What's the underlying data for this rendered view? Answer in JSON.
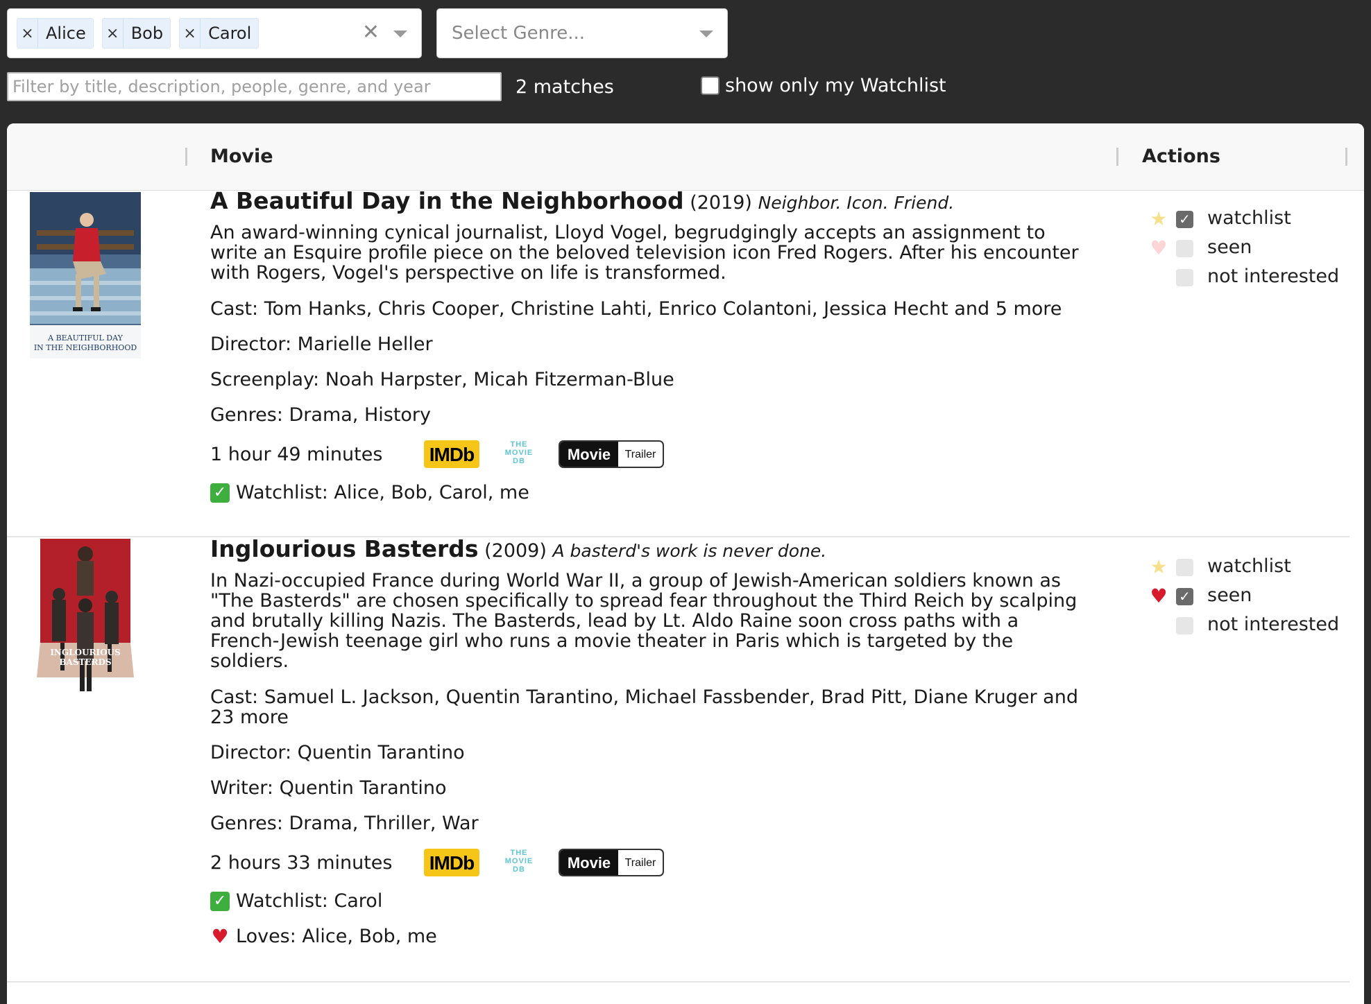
{
  "filters": {
    "people": [
      "Alice",
      "Bob",
      "Carol"
    ],
    "remove_glyph": "×",
    "clear_glyph": "✕",
    "genre_placeholder": "Select Genre...",
    "search_placeholder": "Filter by title, description, people, genre, and year",
    "match_count": "2 matches",
    "watchlist_only_label": "show only my Watchlist",
    "watchlist_only_checked": false
  },
  "table": {
    "columns": {
      "movie": "Movie",
      "actions": "Actions"
    }
  },
  "movies": [
    {
      "title": "A Beautiful Day in the Neighborhood",
      "year": "(2019)",
      "tagline": "Neighbor. Icon. Friend.",
      "description": "An award-winning cynical journalist, Lloyd Vogel, begrudgingly accepts an assignment to write an Esquire profile piece on the beloved television icon Fred Rogers. After his encounter with Rogers, Vogel's perspective on life is transformed.",
      "cast": "Cast: Tom Hanks, Chris Cooper, Christine Lahti, Enrico Colantoni, Jessica Hecht and 5 more",
      "director": "Director: Marielle Heller",
      "writer": "Screenplay: Noah Harpster, Micah Fitzerman-Blue",
      "genres": "Genres: Drama, History",
      "runtime": "1 hour 49 minutes",
      "poster_text": "A BEAUTIFUL DAY IN THE NEIGHBORHOOD",
      "watchlist_line": "Watchlist: Alice, Bob, Carol, me",
      "loves_line": null,
      "actions": {
        "watchlist": true,
        "seen": false,
        "not_interested": false
      }
    },
    {
      "title": "Inglourious Basterds",
      "year": "(2009)",
      "tagline": "A basterd's work is never done.",
      "description": "In Nazi-occupied France during World War II, a group of Jewish-American soldiers known as \"The Basterds\" are chosen specifically to spread fear throughout the Third Reich by scalping and brutally killing Nazis. The Basterds, lead by Lt. Aldo Raine soon cross paths with a French-Jewish teenage girl who runs a movie theater in Paris which is targeted by the soldiers.",
      "cast": "Cast: Samuel L. Jackson, Quentin Tarantino, Michael Fassbender, Brad Pitt, Diane Kruger and 23 more",
      "director": "Director: Quentin Tarantino",
      "writer": "Writer: Quentin Tarantino",
      "genres": "Genres: Drama, Thriller, War",
      "runtime": "2 hours 33 minutes",
      "poster_text": "INGLOURIOUS BASTERDS",
      "watchlist_line": "Watchlist: Carol",
      "loves_line": "Loves: Alice, Bob, me",
      "actions": {
        "watchlist": false,
        "seen": true,
        "not_interested": false
      }
    }
  ],
  "action_labels": {
    "watchlist": "watchlist",
    "seen": "seen",
    "not_interested": "not interested"
  },
  "link_labels": {
    "imdb": "IMDb",
    "tmdb_1": "THE",
    "tmdb_2": "MOVIE",
    "tmdb_3": "DB",
    "trailer_a": "Movie",
    "trailer_b": "Trailer"
  },
  "icons": {
    "watchlist": "star-icon",
    "seen": "heart-icon",
    "watchlist_status": "check-mark-button-icon",
    "loves_status": "red-heart-icon"
  },
  "colors": {
    "imdb": "#f5c518",
    "tmdb": "#5fc4d4",
    "check": "#3eae3e",
    "heart": "#d81b2c",
    "background": "#2b2b2b"
  }
}
